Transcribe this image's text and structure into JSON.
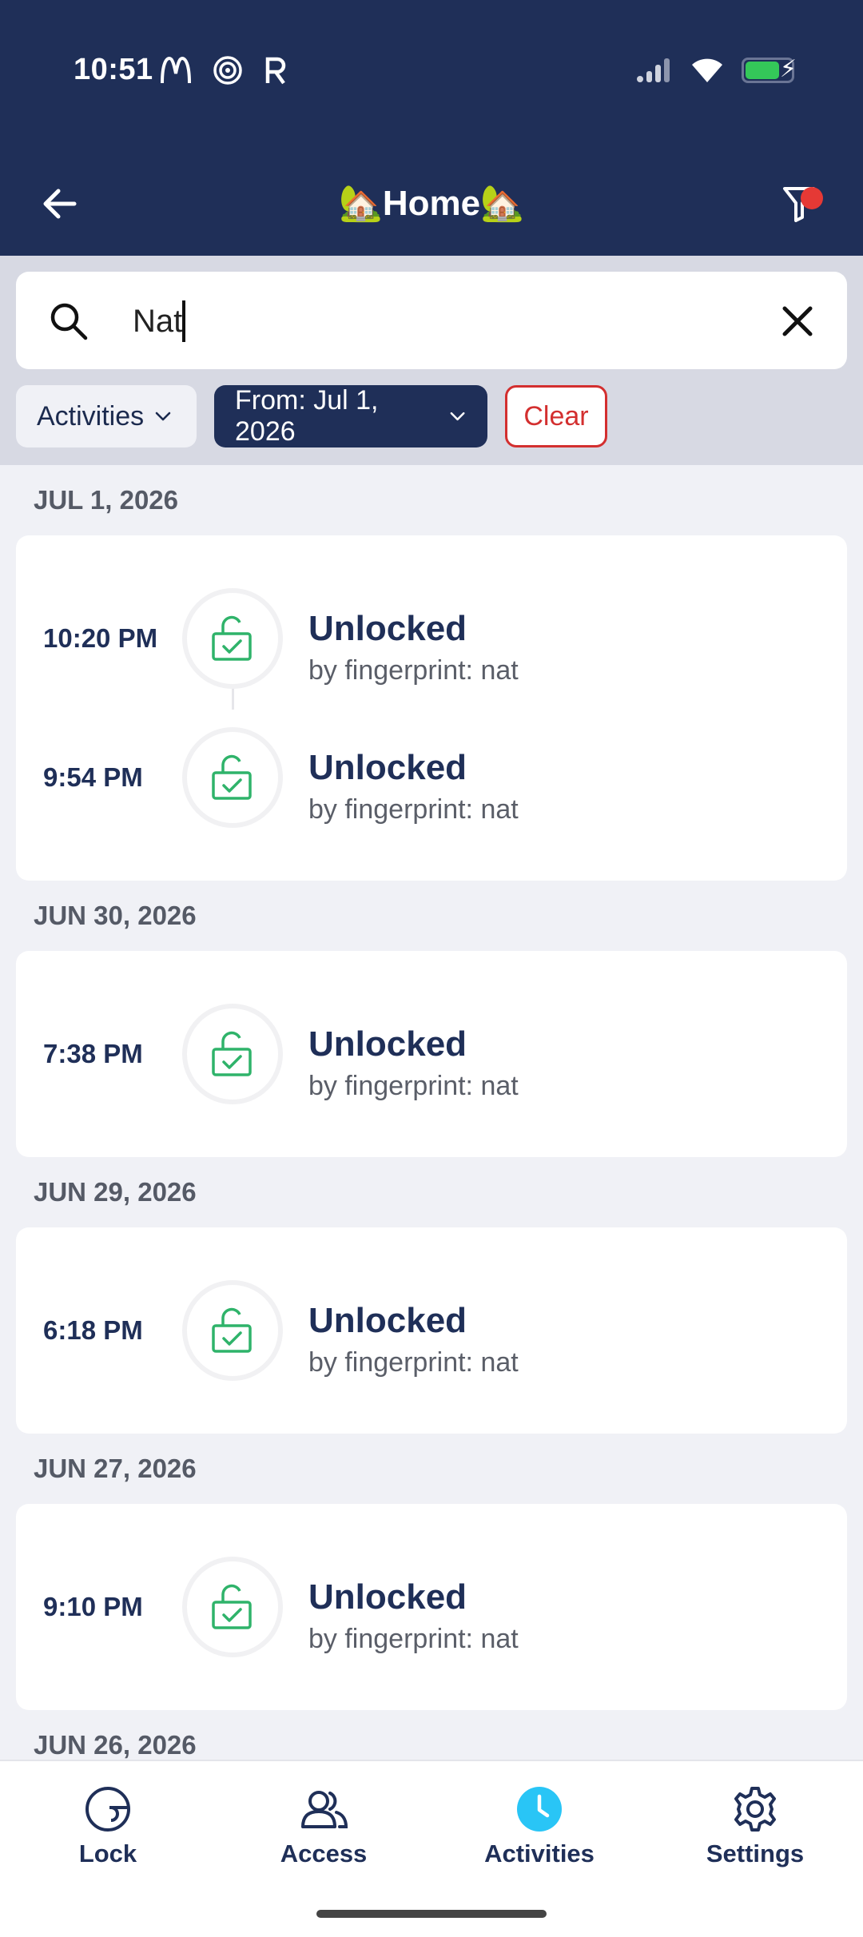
{
  "status_bar": {
    "time": "10:51",
    "left_icons": [
      "mcdonalds-icon",
      "swirl-icon",
      "r-icon"
    ],
    "right_icons": [
      "signal-icon",
      "wifi-icon",
      "battery-charging-icon"
    ]
  },
  "header": {
    "title": "🏡Home🏡",
    "filter_active": true
  },
  "search": {
    "value": "Nat",
    "placeholder": ""
  },
  "filters": {
    "activities_label": "Activities",
    "date_label": "From: Jul 1, 2026",
    "clear_label": "Clear"
  },
  "groups": [
    {
      "date": "JUL 1, 2026",
      "entries": [
        {
          "time": "10:20 PM",
          "title": "Unlocked",
          "subtitle": "by fingerprint: nat"
        },
        {
          "time": "9:54 PM",
          "title": "Unlocked",
          "subtitle": "by fingerprint: nat"
        }
      ]
    },
    {
      "date": "JUN 30, 2026",
      "entries": [
        {
          "time": "7:38 PM",
          "title": "Unlocked",
          "subtitle": "by fingerprint: nat"
        }
      ]
    },
    {
      "date": "JUN 29, 2026",
      "entries": [
        {
          "time": "6:18 PM",
          "title": "Unlocked",
          "subtitle": "by fingerprint: nat"
        }
      ]
    },
    {
      "date": "JUN 27, 2026",
      "entries": [
        {
          "time": "9:10 PM",
          "title": "Unlocked",
          "subtitle": "by fingerprint: nat"
        }
      ]
    },
    {
      "date": "JUN 26, 2026",
      "entries": []
    }
  ],
  "bottom_nav": [
    {
      "label": "Lock",
      "icon": "lock-dial-icon"
    },
    {
      "label": "Access",
      "icon": "users-icon"
    },
    {
      "label": "Activities",
      "icon": "clock-icon",
      "active": true
    },
    {
      "label": "Settings",
      "icon": "gear-icon"
    }
  ],
  "colors": {
    "header_bg": "#1f2f58",
    "accent": "#29c5f6",
    "unlock_green": "#2fb36a",
    "clear_red": "#d32f2f"
  }
}
